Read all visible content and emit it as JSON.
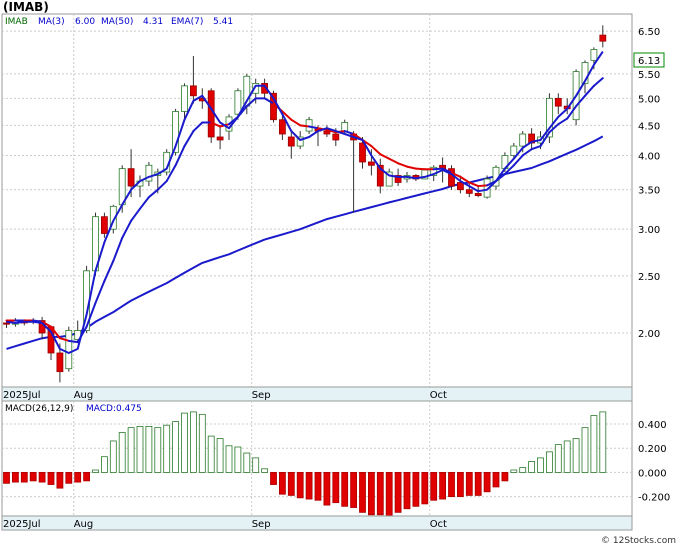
{
  "chart_data": [
    {
      "type": "candlestick",
      "title": "(IMAB)",
      "legend": [
        {
          "label": "IMAB",
          "color": "#000000"
        },
        {
          "label": "MA(3)",
          "value": "6.00",
          "color": "#0000cc"
        },
        {
          "label": "MA(50)",
          "value": "4.31",
          "color": "#0000cc"
        },
        {
          "label": "EMA(7)",
          "value": "5.41",
          "color": "#0000cc"
        }
      ],
      "y_scale": "log",
      "ylim": [
        1.62,
        6.95
      ],
      "y_ticks": [
        {
          "value": 2.0,
          "label": "2.00"
        },
        {
          "value": 2.5,
          "label": "2.50"
        },
        {
          "value": 3.0,
          "label": "3.00"
        },
        {
          "value": 3.5,
          "label": "3.50"
        },
        {
          "value": 4.0,
          "label": "4.00"
        },
        {
          "value": 4.5,
          "label": "4.50"
        },
        {
          "value": 5.0,
          "label": "5.00"
        },
        {
          "value": 5.5,
          "label": "5.50"
        },
        {
          "value": 6.5,
          "label": "6.50"
        }
      ],
      "last_price_label": "6.13",
      "last_price": 6.13,
      "month_labels": [
        {
          "index": 0,
          "label": "2025Jul"
        },
        {
          "index": 8,
          "label": "Aug"
        },
        {
          "index": 28,
          "label": "Sep"
        },
        {
          "index": 48,
          "label": "Oct"
        }
      ],
      "candles": [
        [
          2.08,
          2.1,
          2.04,
          2.07
        ],
        [
          2.07,
          2.12,
          2.05,
          2.1
        ],
        [
          2.09,
          2.11,
          2.06,
          2.08
        ],
        [
          2.09,
          2.12,
          2.07,
          2.1
        ],
        [
          2.1,
          2.13,
          1.95,
          2.0
        ],
        [
          2.05,
          2.06,
          1.8,
          1.85
        ],
        [
          1.85,
          1.92,
          1.65,
          1.72
        ],
        [
          1.74,
          2.05,
          1.72,
          2.02
        ],
        [
          1.95,
          2.1,
          1.93,
          2.02
        ],
        [
          2.02,
          2.6,
          2.0,
          2.55
        ],
        [
          2.55,
          3.2,
          2.5,
          3.15
        ],
        [
          3.15,
          3.2,
          2.9,
          2.95
        ],
        [
          3.0,
          3.3,
          2.95,
          3.28
        ],
        [
          3.3,
          3.85,
          3.2,
          3.8
        ],
        [
          3.8,
          4.1,
          3.4,
          3.55
        ],
        [
          3.55,
          3.7,
          3.4,
          3.62
        ],
        [
          3.62,
          3.9,
          3.55,
          3.85
        ],
        [
          3.7,
          3.8,
          3.45,
          3.75
        ],
        [
          3.75,
          4.1,
          3.7,
          4.05
        ],
        [
          4.05,
          4.8,
          4.0,
          4.75
        ],
        [
          4.75,
          5.3,
          4.6,
          5.25
        ],
        [
          5.25,
          5.9,
          4.9,
          5.05
        ],
        [
          5.0,
          5.2,
          4.8,
          4.95
        ],
        [
          5.15,
          5.2,
          4.2,
          4.3
        ],
        [
          4.3,
          4.5,
          4.1,
          4.25
        ],
        [
          4.4,
          4.7,
          4.25,
          4.65
        ],
        [
          4.7,
          5.2,
          4.6,
          5.15
        ],
        [
          4.85,
          5.5,
          4.7,
          5.45
        ],
        [
          5.1,
          5.4,
          4.9,
          5.3
        ],
        [
          5.3,
          5.4,
          5.0,
          5.1
        ],
        [
          5.1,
          5.15,
          4.55,
          4.6
        ],
        [
          4.6,
          4.7,
          4.25,
          4.35
        ],
        [
          4.3,
          4.4,
          3.95,
          4.15
        ],
        [
          4.15,
          4.4,
          4.1,
          4.3
        ],
        [
          4.4,
          4.65,
          4.35,
          4.6
        ],
        [
          4.45,
          4.5,
          4.15,
          4.4
        ],
        [
          4.4,
          4.5,
          4.3,
          4.35
        ],
        [
          4.35,
          4.45,
          4.15,
          4.25
        ],
        [
          4.4,
          4.6,
          4.35,
          4.55
        ],
        [
          4.35,
          4.4,
          3.2,
          4.25
        ],
        [
          4.2,
          4.3,
          3.8,
          3.9
        ],
        [
          3.9,
          4.1,
          3.7,
          3.85
        ],
        [
          3.85,
          3.95,
          3.45,
          3.55
        ],
        [
          3.55,
          3.8,
          3.55,
          3.75
        ],
        [
          3.7,
          3.8,
          3.55,
          3.6
        ],
        [
          3.65,
          3.75,
          3.6,
          3.7
        ],
        [
          3.7,
          3.72,
          3.62,
          3.65
        ],
        [
          3.65,
          3.8,
          3.65,
          3.78
        ],
        [
          3.7,
          3.85,
          3.62,
          3.82
        ],
        [
          3.85,
          3.97,
          3.6,
          3.8
        ],
        [
          3.8,
          3.85,
          3.5,
          3.55
        ],
        [
          3.6,
          3.7,
          3.45,
          3.5
        ],
        [
          3.5,
          3.6,
          3.4,
          3.45
        ],
        [
          3.45,
          3.55,
          3.4,
          3.42
        ],
        [
          3.4,
          3.7,
          3.38,
          3.65
        ],
        [
          3.55,
          3.85,
          3.5,
          3.82
        ],
        [
          3.8,
          4.05,
          3.75,
          4.0
        ],
        [
          4.0,
          4.2,
          3.95,
          4.15
        ],
        [
          4.15,
          4.4,
          4.05,
          4.35
        ],
        [
          4.35,
          4.45,
          4.1,
          4.2
        ],
        [
          4.2,
          4.4,
          4.1,
          4.3
        ],
        [
          4.3,
          5.1,
          4.2,
          5.0
        ],
        [
          5.0,
          5.1,
          4.7,
          4.85
        ],
        [
          4.85,
          5.0,
          4.7,
          4.8
        ],
        [
          4.6,
          5.6,
          4.5,
          5.55
        ],
        [
          5.3,
          5.8,
          5.1,
          5.75
        ],
        [
          5.8,
          6.1,
          5.6,
          6.05
        ],
        [
          6.4,
          6.65,
          6.1,
          6.25
        ]
      ],
      "ma3": [
        2.09,
        2.08,
        2.09,
        2.09,
        2.08,
        2.01,
        1.88,
        1.85,
        1.88,
        2.15,
        2.55,
        2.85,
        3.1,
        3.3,
        3.5,
        3.62,
        3.68,
        3.72,
        3.8,
        4.15,
        4.6,
        4.95,
        5.05,
        4.8,
        4.55,
        4.45,
        4.65,
        4.95,
        5.25,
        5.25,
        5.0,
        4.7,
        4.4,
        4.25,
        4.3,
        4.4,
        4.45,
        4.4,
        4.35,
        4.3,
        4.25,
        4.0,
        3.8,
        3.7,
        3.68,
        3.68,
        3.66,
        3.68,
        3.72,
        3.78,
        3.72,
        3.62,
        3.55,
        3.48,
        3.5,
        3.62,
        3.8,
        3.95,
        4.12,
        4.22,
        4.25,
        4.45,
        4.65,
        4.8,
        5.05,
        5.35,
        5.7,
        6.0
      ],
      "ma50": [
        1.88,
        1.9,
        1.92,
        1.94,
        1.96,
        1.97,
        1.97,
        1.98,
        2.0,
        2.04,
        2.09,
        2.13,
        2.17,
        2.22,
        2.27,
        2.31,
        2.35,
        2.39,
        2.43,
        2.48,
        2.53,
        2.58,
        2.63,
        2.66,
        2.69,
        2.72,
        2.76,
        2.8,
        2.84,
        2.88,
        2.91,
        2.94,
        2.97,
        3.0,
        3.04,
        3.08,
        3.12,
        3.15,
        3.18,
        3.21,
        3.24,
        3.27,
        3.3,
        3.33,
        3.36,
        3.39,
        3.42,
        3.45,
        3.48,
        3.51,
        3.55,
        3.58,
        3.6,
        3.63,
        3.66,
        3.69,
        3.72,
        3.75,
        3.78,
        3.81,
        3.86,
        3.91,
        3.97,
        4.03,
        4.09,
        4.16,
        4.23,
        4.31
      ],
      "ema7": [
        2.1,
        2.1,
        2.1,
        2.1,
        2.09,
        2.05,
        1.96,
        1.94,
        1.93,
        2.05,
        2.25,
        2.45,
        2.65,
        2.9,
        3.1,
        3.25,
        3.4,
        3.5,
        3.62,
        3.85,
        4.15,
        4.4,
        4.55,
        4.55,
        4.48,
        4.52,
        4.65,
        4.85,
        5.0,
        5.0,
        4.9,
        4.75,
        4.6,
        4.5,
        4.48,
        4.45,
        4.42,
        4.38,
        4.4,
        4.35,
        4.25,
        4.15,
        4.02,
        3.95,
        3.88,
        3.83,
        3.8,
        3.79,
        3.79,
        3.8,
        3.74,
        3.68,
        3.6,
        3.55,
        3.56,
        3.62,
        3.72,
        3.85,
        4.0,
        4.1,
        4.15,
        4.38,
        4.52,
        4.62,
        4.85,
        5.05,
        5.25,
        5.41
      ]
    },
    {
      "type": "bar",
      "title": "MACD(26,12,9)",
      "legend_value_label": "MACD:0.475",
      "ylim": [
        -0.36,
        0.59
      ],
      "y_ticks": [
        {
          "value": 0.4,
          "label": "0.400"
        },
        {
          "value": 0.2,
          "label": "0.200"
        },
        {
          "value": 0.0,
          "label": "0.000"
        },
        {
          "value": -0.2,
          "label": "-0.200"
        }
      ],
      "values": [
        -0.09,
        -0.08,
        -0.08,
        -0.07,
        -0.08,
        -0.1,
        -0.13,
        -0.09,
        -0.08,
        -0.07,
        0.02,
        0.13,
        0.26,
        0.33,
        0.37,
        0.38,
        0.38,
        0.37,
        0.39,
        0.42,
        0.49,
        0.5,
        0.48,
        0.3,
        0.28,
        0.22,
        0.21,
        0.16,
        0.12,
        0.03,
        -0.1,
        -0.18,
        -0.19,
        -0.21,
        -0.22,
        -0.23,
        -0.27,
        -0.25,
        -0.28,
        -0.29,
        -0.33,
        -0.35,
        -0.35,
        -0.36,
        -0.33,
        -0.3,
        -0.28,
        -0.26,
        -0.23,
        -0.22,
        -0.2,
        -0.2,
        -0.19,
        -0.19,
        -0.16,
        -0.12,
        -0.07,
        0.02,
        0.04,
        0.09,
        0.12,
        0.17,
        0.23,
        0.26,
        0.28,
        0.37,
        0.47,
        0.5
      ]
    }
  ],
  "watermark": "© 12Stocks.com"
}
